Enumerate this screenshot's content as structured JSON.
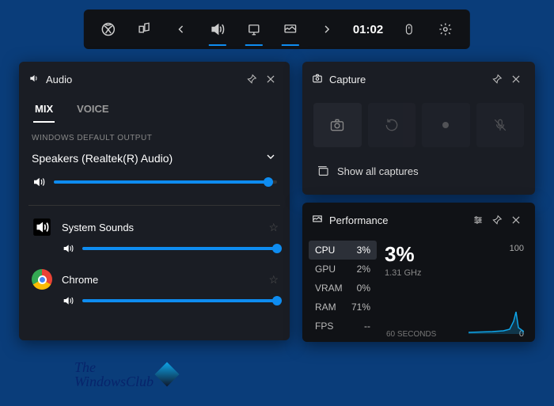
{
  "topbar": {
    "time": "01:02"
  },
  "audio": {
    "title": "Audio",
    "tabs": {
      "mix": "MIX",
      "voice": "VOICE"
    },
    "section_label": "WINDOWS DEFAULT OUTPUT",
    "device": "Speakers (Realtek(R) Audio)",
    "apps": [
      {
        "name": "System Sounds"
      },
      {
        "name": "Chrome"
      }
    ]
  },
  "capture": {
    "title": "Capture",
    "show_all": "Show all captures"
  },
  "perf": {
    "title": "Performance",
    "items": [
      {
        "label": "CPU",
        "val": "3%"
      },
      {
        "label": "GPU",
        "val": "2%"
      },
      {
        "label": "VRAM",
        "val": "0%"
      },
      {
        "label": "RAM",
        "val": "71%"
      },
      {
        "label": "FPS",
        "val": "--"
      }
    ],
    "big": "3%",
    "sub": "1.31 GHz",
    "ymax": "100",
    "ymin": "0",
    "xlabel": "60 SECONDS"
  },
  "watermark": {
    "line1": "The",
    "line2": "WindowsClub"
  },
  "chart_data": {
    "type": "line",
    "title": "CPU usage",
    "ylabel": "%",
    "ylim": [
      0,
      100
    ],
    "xlabel": "60 SECONDS",
    "x": [
      0,
      10,
      20,
      30,
      40,
      50,
      55,
      58,
      60
    ],
    "values": [
      2,
      2,
      2,
      2,
      3,
      3,
      8,
      25,
      5
    ]
  }
}
